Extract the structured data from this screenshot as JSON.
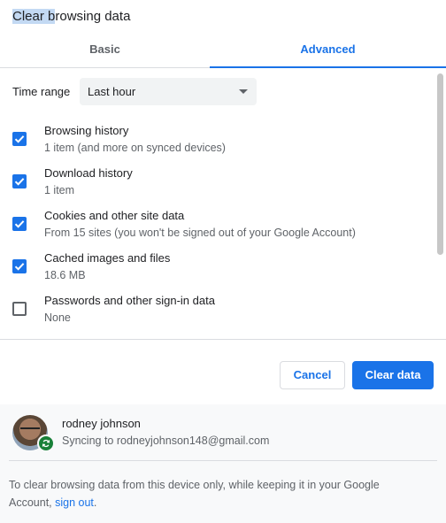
{
  "dialog": {
    "title_selected": "Clear b",
    "title_rest": "rowsing data"
  },
  "tabs": [
    {
      "label": "Basic",
      "active": false
    },
    {
      "label": "Advanced",
      "active": true
    }
  ],
  "time_range": {
    "label": "Time range",
    "value": "Last hour"
  },
  "options": [
    {
      "label": "Browsing history",
      "sub": "1 item (and more on synced devices)",
      "checked": true
    },
    {
      "label": "Download history",
      "sub": "1 item",
      "checked": true
    },
    {
      "label": "Cookies and other site data",
      "sub": "From 15 sites (you won't be signed out of your Google Account)",
      "checked": true
    },
    {
      "label": "Cached images and files",
      "sub": "18.6 MB",
      "checked": true
    },
    {
      "label": "Passwords and other sign-in data",
      "sub": "None",
      "checked": false
    }
  ],
  "buttons": {
    "cancel": "Cancel",
    "clear": "Clear data"
  },
  "account": {
    "name": "rodney johnson",
    "sync": "Syncing to rodneyjohnson148@gmail.com"
  },
  "footer": {
    "note": "To clear browsing data from this device only, while keeping it in your Google Account,",
    "link": "sign out",
    "end": "."
  },
  "colors": {
    "accent": "#1a73e8",
    "sync_badge": "#188038"
  }
}
